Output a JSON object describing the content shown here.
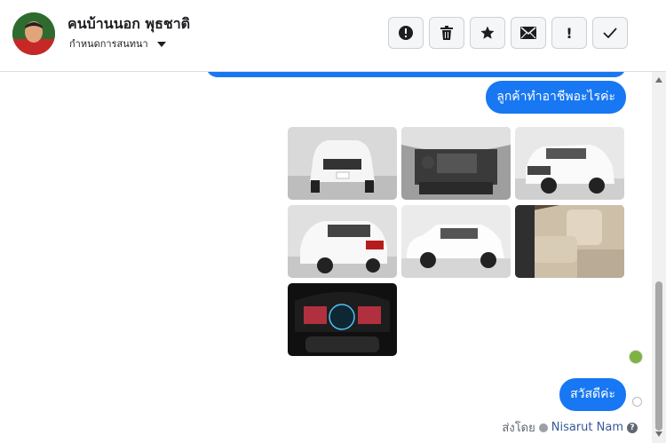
{
  "header": {
    "contact_name": "คนบ้านนอก พุธชาติ",
    "assign_label": "กำหนดการสนทนา"
  },
  "toolbar": {
    "buttons": [
      {
        "icon": "alert-circle-icon"
      },
      {
        "icon": "trash-icon"
      },
      {
        "icon": "star-icon"
      },
      {
        "icon": "envelope-icon"
      },
      {
        "icon": "exclamation-icon",
        "text": "!"
      },
      {
        "icon": "checkmark-icon"
      }
    ]
  },
  "messages": [
    {
      "text": "ลูกค้าทำอาชีพอะไรค่ะ"
    },
    {
      "text": "สวัสดีค่ะ"
    }
  ],
  "photos": [
    {
      "subject": "white SUV front view"
    },
    {
      "subject": "engine bay"
    },
    {
      "subject": "SUV front three-quarter view"
    },
    {
      "subject": "SUV rear three-quarter view"
    },
    {
      "subject": "SUV side view"
    },
    {
      "subject": "beige rear seats interior"
    },
    {
      "subject": "instrument cluster"
    }
  ],
  "footer": {
    "sent_by_label": "ส่งโดย",
    "sender_name": "Nisarut Nam",
    "help_glyph": "?"
  },
  "colors": {
    "bubble": "#1877f2",
    "link": "#385898"
  }
}
